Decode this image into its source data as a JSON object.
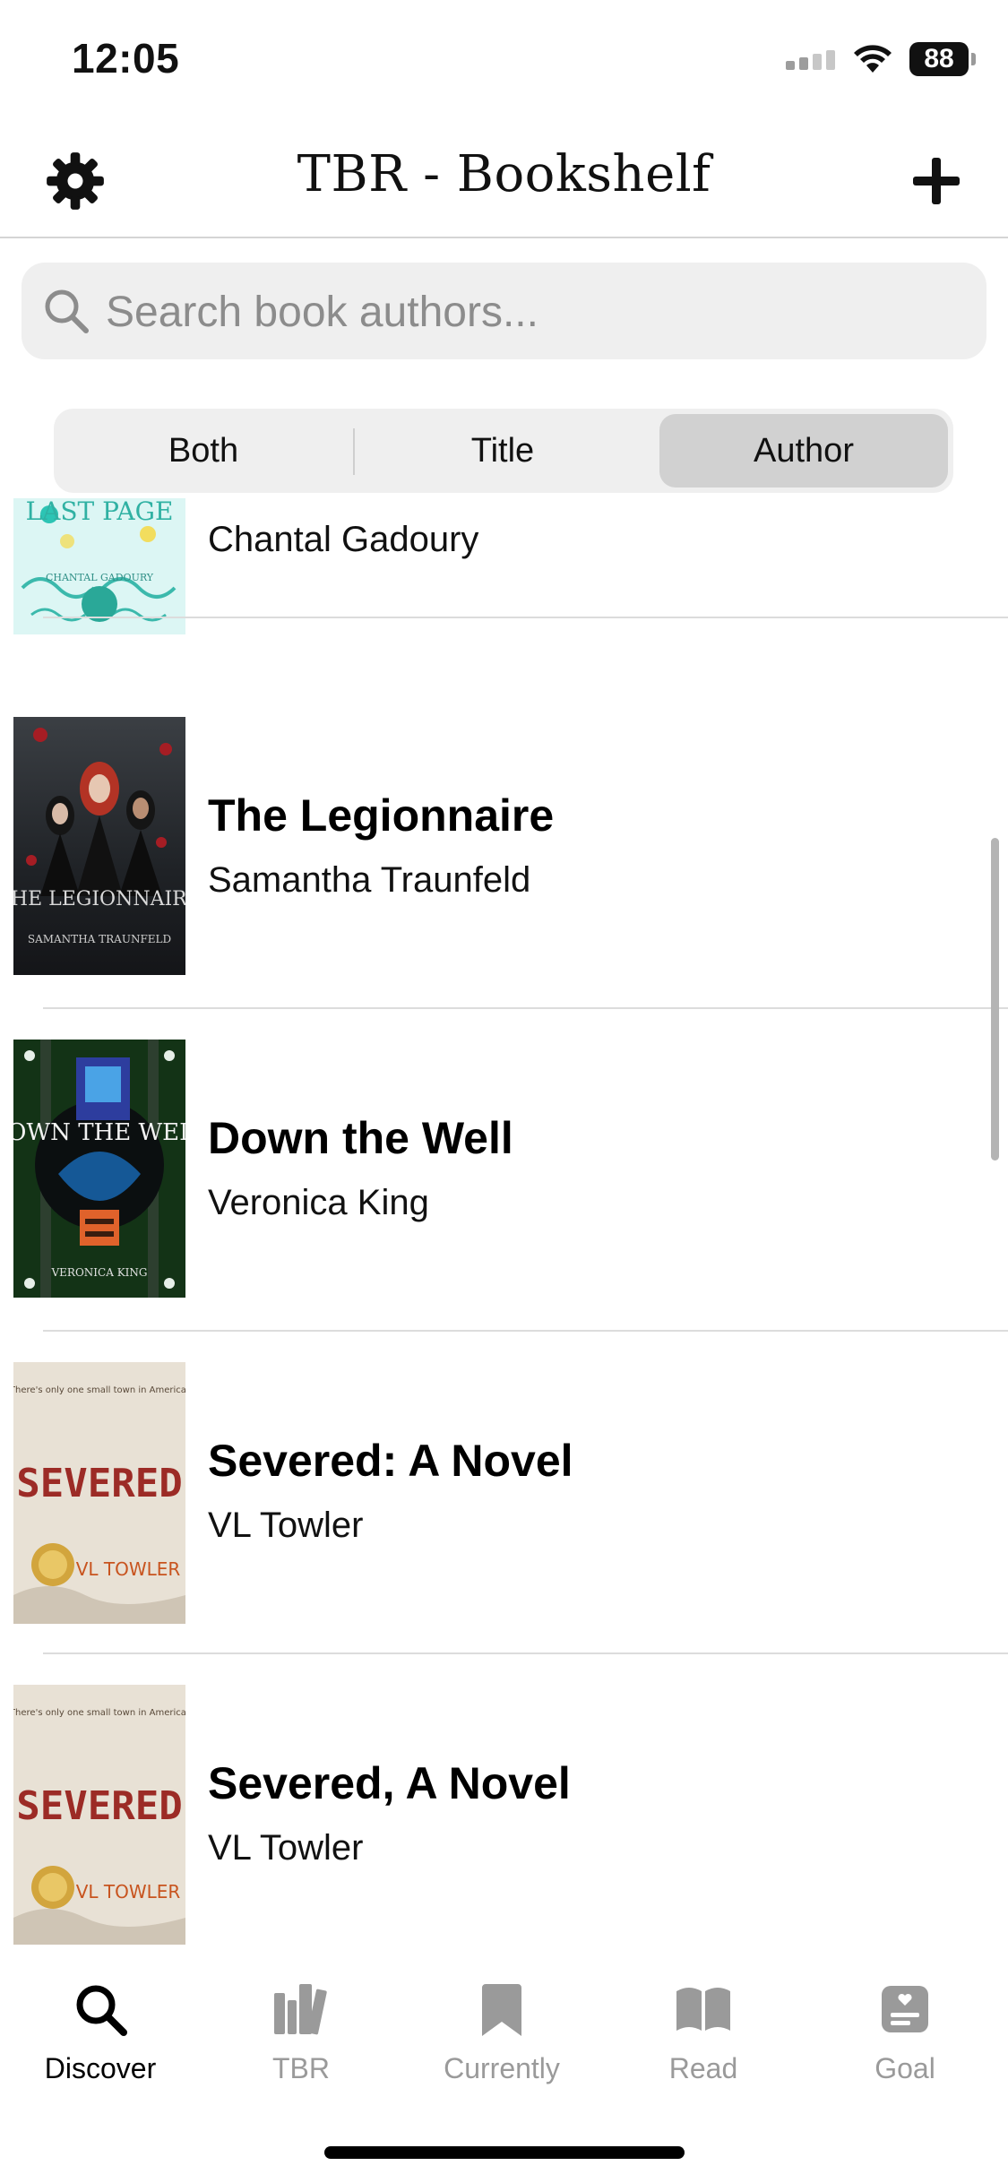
{
  "status_bar": {
    "time": "12:05",
    "battery": "88",
    "icons": [
      "cellular-signal-icon",
      "wifi-icon",
      "battery-icon"
    ]
  },
  "nav": {
    "title": "TBR - Bookshelf",
    "settings_icon": "gear-icon",
    "add_icon": "plus-icon"
  },
  "search": {
    "placeholder": "Search book authors...",
    "value": ""
  },
  "segments": {
    "items": [
      "Both",
      "Title",
      "Author"
    ],
    "selected": "Author"
  },
  "books": [
    {
      "title": "",
      "author": "Chantal Gadoury",
      "cover_text": "LAST PAGE",
      "cover_subtitle": "CHANTAL GADOURY"
    },
    {
      "title": "The Legionnaire",
      "author": "Samantha Traunfeld",
      "cover_text": "THE LEGIONNAIRE",
      "cover_subtitle": "SAMANTHA TRAUNFELD"
    },
    {
      "title": "Down the Well",
      "author": "Veronica King",
      "cover_text": "DOWN THE WELL",
      "cover_subtitle": "VERONICA KING"
    },
    {
      "title": "Severed: A Novel",
      "author": "VL Towler",
      "cover_text": "SEVERED",
      "cover_subtitle": "VL TOWLER"
    },
    {
      "title": "Severed, A Novel",
      "author": "VL Towler",
      "cover_text": "SEVERED",
      "cover_subtitle": "VL TOWLER"
    }
  ],
  "tabs": [
    {
      "label": "Discover",
      "icon": "search-icon",
      "active": true
    },
    {
      "label": "TBR",
      "icon": "books-icon",
      "active": false
    },
    {
      "label": "Currently",
      "icon": "bookmark-icon",
      "active": false
    },
    {
      "label": "Read",
      "icon": "open-book-icon",
      "active": false
    },
    {
      "label": "Goal",
      "icon": "goal-note-icon",
      "active": false
    }
  ],
  "colors": {
    "accent": "#000000",
    "inactive": "#9a9a9a",
    "search_bg": "#efefef",
    "segment_selected": "#d1d1d1"
  }
}
